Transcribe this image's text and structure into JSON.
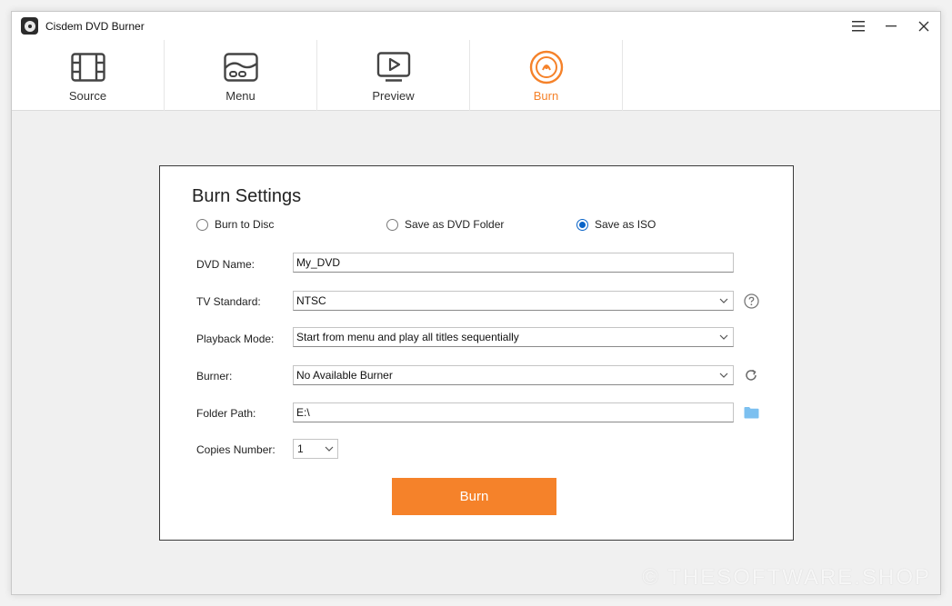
{
  "window": {
    "title": "Cisdem DVD Burner"
  },
  "nav": {
    "items": [
      {
        "label": "Source",
        "icon": "film-icon"
      },
      {
        "label": "Menu",
        "icon": "menu-layout-icon"
      },
      {
        "label": "Preview",
        "icon": "play-screen-icon"
      },
      {
        "label": "Burn",
        "icon": "burn-disc-icon",
        "active": true
      }
    ]
  },
  "settings": {
    "title": "Burn Settings",
    "options": [
      {
        "label": "Burn to Disc",
        "checked": false
      },
      {
        "label": "Save as DVD Folder",
        "checked": false
      },
      {
        "label": "Save as ISO",
        "checked": true
      }
    ],
    "dvd_name": {
      "label": "DVD Name:",
      "value": "My_DVD"
    },
    "tv_standard": {
      "label": "TV Standard:",
      "value": "NTSC"
    },
    "playback_mode": {
      "label": "Playback Mode:",
      "value": "Start from menu and play all titles sequentially"
    },
    "burner": {
      "label": "Burner:",
      "value": "No Available Burner"
    },
    "folder_path": {
      "label": "Folder Path:",
      "value": "E:\\"
    },
    "copies": {
      "label": "Copies Number:",
      "value": "1"
    },
    "burn_button": "Burn"
  },
  "watermark": "© THESOFTWARE.SHOP",
  "colors": {
    "accent": "#f5822a",
    "radio": "#0a64c8",
    "folder": "#7cc0f0"
  }
}
